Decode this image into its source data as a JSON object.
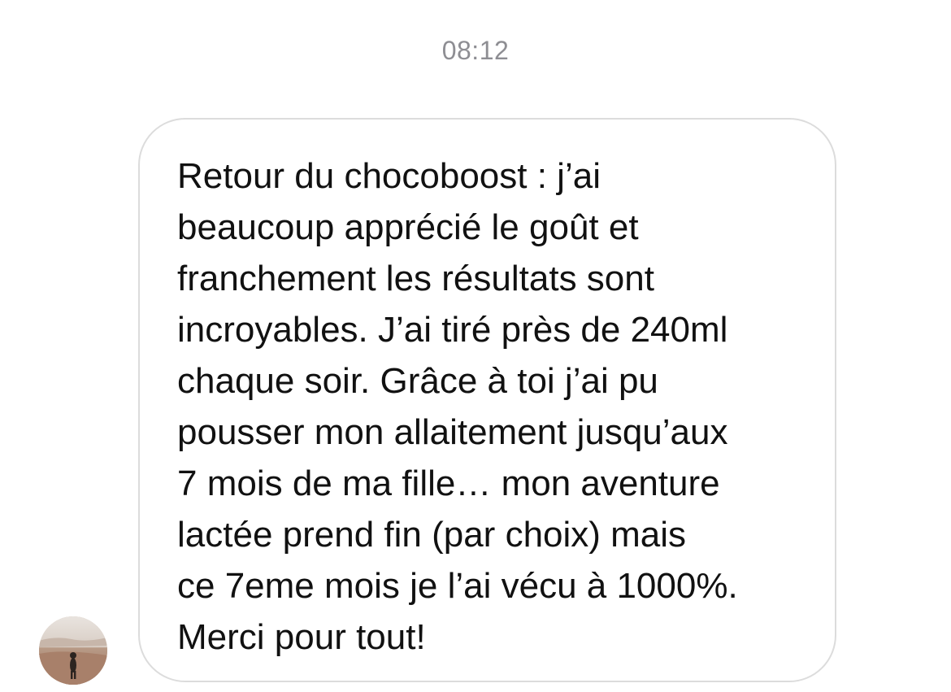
{
  "thread": {
    "timestamp": "08:12"
  },
  "message": {
    "lines": [
      "Retour du chocoboost : j’ai",
      "beaucoup apprécié le goût et",
      "franchement les résultats sont",
      "incroyables. J’ai tiré près de 240ml",
      "chaque soir. Grâce à toi j’ai pu",
      "pousser mon allaitement jusqu’aux",
      "7 mois de ma fille… mon aventure",
      "lactée prend fin (par choix) mais",
      "ce 7eme mois je l’ai vécu à 1000%.",
      "Merci pour tout!"
    ]
  },
  "sender": {
    "avatar_icon": "profile-photo-beach"
  },
  "colors": {
    "bubble_border": "#dcdcdc",
    "timestamp": "#8e8e93",
    "text": "#111111"
  }
}
